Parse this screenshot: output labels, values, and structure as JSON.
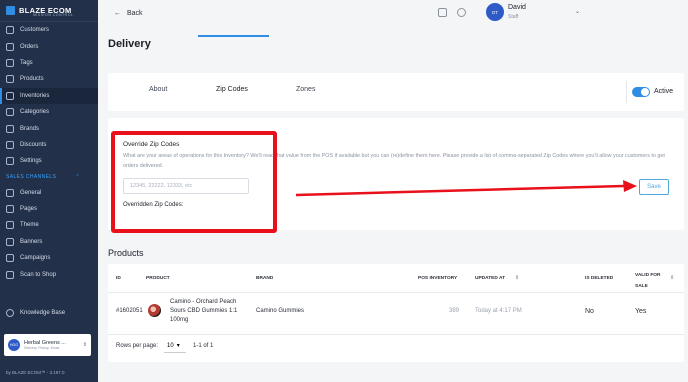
{
  "brand": {
    "name": "BLAZE ECOM",
    "tagline": "MISSION CONTROL",
    "version": "by BLAZE ECOM™ - 3.197.0"
  },
  "sidebar": {
    "items": [
      {
        "label": "Customers",
        "icon": "customers-icon"
      },
      {
        "label": "Orders",
        "icon": "orders-icon"
      },
      {
        "label": "Tags",
        "icon": "tag-icon"
      },
      {
        "label": "Products",
        "icon": "products-icon"
      },
      {
        "label": "Inventories",
        "icon": "inventory-icon",
        "active": true
      },
      {
        "label": "Categories",
        "icon": "categories-icon"
      },
      {
        "label": "Brands",
        "icon": "brands-icon"
      },
      {
        "label": "Discounts",
        "icon": "discount-icon"
      },
      {
        "label": "Settings",
        "icon": "settings-icon"
      }
    ],
    "section_label": "SALES CHANNELS",
    "channel_items": [
      {
        "label": "General",
        "icon": "general-icon"
      },
      {
        "label": "Pages",
        "icon": "pages-icon"
      },
      {
        "label": "Theme",
        "icon": "theme-icon"
      },
      {
        "label": "Banners",
        "icon": "banners-icon"
      },
      {
        "label": "Campaigns",
        "icon": "campaigns-icon"
      },
      {
        "label": "Scan to Shop",
        "icon": "scan-icon"
      }
    ],
    "knowledge_base": "Knowledge Base",
    "store": {
      "avatar": "HGG",
      "name": "Herbal Greens ...",
      "sub": "Delivery, Pickup, Kiosk"
    }
  },
  "topbar": {
    "back_label": "Back",
    "user": {
      "initials": "DT",
      "name": "David",
      "role": "Staff"
    }
  },
  "page_title": "Delivery",
  "tabs": [
    {
      "label": "About"
    },
    {
      "label": "Zip Codes",
      "active": true
    },
    {
      "label": "Zones"
    }
  ],
  "active_toggle": {
    "label": "Active",
    "on": true
  },
  "zip": {
    "title": "Override Zip Codes",
    "description": "What are your areas of operations for this Inventory? We'll read that value from the POS if available but you can (re)define them here. Please provide a list of comma-separated Zip Codes where you'll allow your customers to get orders delivered.",
    "placeholder": "12345, 22222, 12333, etc",
    "overridden_label": "Overridden Zip Codes:",
    "save_label": "Save"
  },
  "products": {
    "title": "Products",
    "columns": [
      "ID",
      "PRODUCT",
      "BRAND",
      "POS INVENTORY",
      "UPDATED AT",
      "IS DELETED",
      "VALID FOR SALE"
    ],
    "rows": [
      {
        "id": "#1602051",
        "product": "Camino - Orchard Peach Sours CBD Gummies 1:1 100mg",
        "brand": "Camino Gummies",
        "pos_inventory": "389",
        "updated_at": "Today at 4:17 PM",
        "is_deleted": "No",
        "valid_for_sale": "Yes"
      }
    ],
    "rows_per_page_label": "Rows per page:",
    "rows_per_page": "10",
    "range": "1-1 of 1"
  },
  "colors": {
    "accent": "#2f8de4",
    "sidebar": "#22304a",
    "highlight": "#e8101a"
  }
}
